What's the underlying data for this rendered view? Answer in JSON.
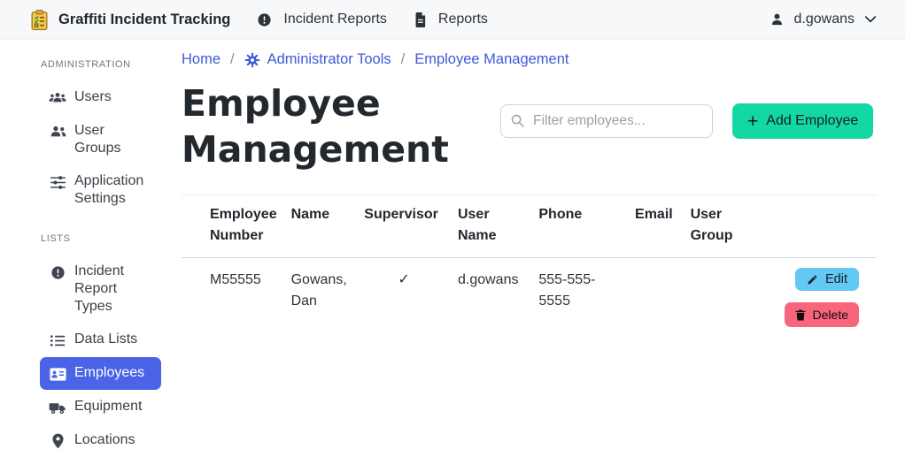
{
  "navbar": {
    "brand_title": "Graffiti Incident Tracking",
    "links": [
      {
        "label": "Incident Reports"
      },
      {
        "label": "Reports"
      }
    ],
    "user_label": "d.gowans"
  },
  "sidebar": {
    "sections": [
      {
        "label": "ADMINISTRATION",
        "items": [
          {
            "label": "Users"
          },
          {
            "label": "User Groups"
          },
          {
            "label": "Application Settings"
          }
        ]
      },
      {
        "label": "LISTS",
        "items": [
          {
            "label": "Incident Report Types"
          },
          {
            "label": "Data Lists"
          },
          {
            "label": "Employees",
            "active": true
          },
          {
            "label": "Equipment"
          },
          {
            "label": "Locations"
          }
        ]
      }
    ]
  },
  "breadcrumb": {
    "items": [
      "Home",
      "Administrator Tools",
      "Employee Management"
    ],
    "separator": "/"
  },
  "page": {
    "title": "Employee Management"
  },
  "search": {
    "placeholder": "Filter employees...",
    "value": ""
  },
  "buttons": {
    "add_employee": "Add Employee",
    "plus": "+",
    "edit": "Edit",
    "delete": "Delete"
  },
  "table": {
    "headers": [
      "Employee Number",
      "Name",
      "Supervisor",
      "User Name",
      "Phone",
      "Email",
      "User Group"
    ],
    "rows": [
      {
        "employee_number": "M55555",
        "name": "Gowans, Dan",
        "supervisor": "✓",
        "user_name": "d.gowans",
        "phone": "555-555-5555",
        "email": "",
        "user_group": ""
      }
    ]
  },
  "colors": {
    "sidebar_active_bg": "#4a63e7",
    "breadcrumb_link": "#3c5ada",
    "add_button_bg": "#13d7a5",
    "edit_button_bg": "#62c9f3",
    "delete_button_bg": "#f8657c",
    "navbar_bg": "#f7f8fa",
    "logo_yellow": "#f2c94c"
  }
}
